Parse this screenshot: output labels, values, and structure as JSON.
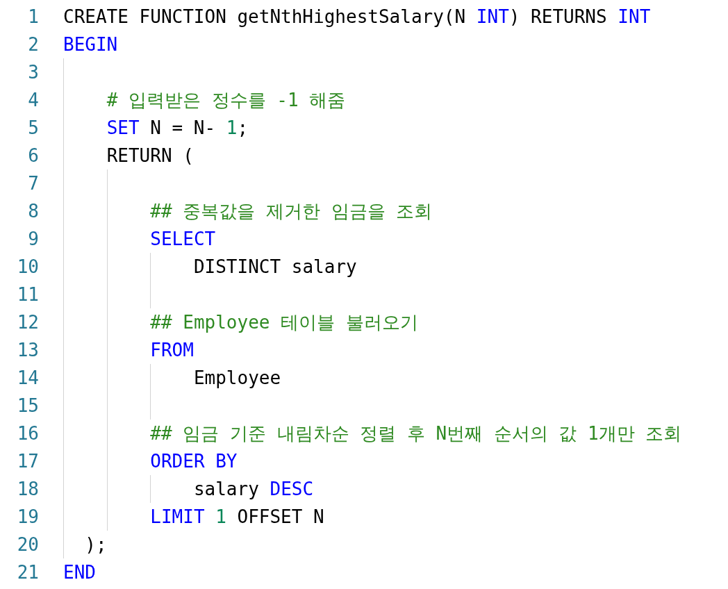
{
  "editor": {
    "lines": [
      {
        "number": "1",
        "tokens": [
          {
            "text": "CREATE FUNCTION getNthHighestSalary(N ",
            "kind": "plain"
          },
          {
            "text": "INT",
            "kind": "keyword"
          },
          {
            "text": ") RETURNS ",
            "kind": "plain"
          },
          {
            "text": "INT",
            "kind": "keyword"
          }
        ]
      },
      {
        "number": "2",
        "tokens": [
          {
            "text": "BEGIN",
            "kind": "keyword"
          }
        ]
      },
      {
        "number": "3"
      },
      {
        "number": "4",
        "kind": "single",
        "tokens": [
          {
            "text": "# 입력받은 정수를 -1 해줌",
            "kind": "comment"
          }
        ]
      },
      {
        "number": "5",
        "kind": "single",
        "tokens": [
          {
            "text": "SET",
            "kind": "keyword"
          },
          {
            "text": " N = N- ",
            "kind": "plain"
          },
          {
            "text": "1",
            "kind": "number"
          },
          {
            "text": ";",
            "kind": "plain"
          }
        ]
      },
      {
        "number": "6",
        "kind": "single",
        "tokens": [
          {
            "text": "RETURN (",
            "kind": "plain"
          }
        ]
      },
      {
        "number": "7"
      },
      {
        "number": "8",
        "kind": "double",
        "tokens": [
          {
            "text": "## 중복값을 제거한 임금을 조회",
            "kind": "comment"
          }
        ]
      },
      {
        "number": "9",
        "kind": "double",
        "tokens": [
          {
            "text": "SELECT",
            "kind": "keyword"
          }
        ]
      },
      {
        "number": "10",
        "kind": "triple",
        "tokens": [
          {
            "text": "DISTINCT salary",
            "kind": "plain"
          }
        ]
      },
      {
        "number": "11"
      },
      {
        "number": "12",
        "kind": "double",
        "tokens": [
          {
            "text": "## Employee 테이블 불러오기",
            "kind": "comment"
          }
        ]
      },
      {
        "number": "13",
        "kind": "double",
        "tokens": [
          {
            "text": "FROM",
            "kind": "keyword"
          }
        ]
      },
      {
        "number": "14",
        "kind": "triple",
        "tokens": [
          {
            "text": "Employee",
            "kind": "plain"
          }
        ]
      },
      {
        "number": "15"
      },
      {
        "number": "16",
        "kind": "double",
        "tokens": [
          {
            "text": "## 임금 기준 내림차순 정렬 후 N번째 순서의 값 1개만 조회",
            "kind": "comment"
          }
        ]
      },
      {
        "number": "17",
        "kind": "double",
        "tokens": [
          {
            "text": "ORDER BY",
            "kind": "keyword"
          }
        ]
      },
      {
        "number": "18",
        "kind": "triple",
        "tokens": [
          {
            "text": "salary ",
            "kind": "plain"
          },
          {
            "text": "DESC",
            "kind": "keyword"
          }
        ]
      },
      {
        "number": "19",
        "kind": "double",
        "tokens": [
          {
            "text": "LIMIT ",
            "kind": "keyword"
          },
          {
            "text": "1",
            "kind": "number"
          },
          {
            "text": " OFFSET N",
            "kind": "plain"
          }
        ]
      },
      {
        "number": "20",
        "kind": "half",
        "tokens": [
          {
            "text": ");",
            "kind": "plain"
          }
        ]
      },
      {
        "number": "21",
        "tokens": [
          {
            "text": "END",
            "kind": "keyword"
          }
        ]
      }
    ]
  }
}
